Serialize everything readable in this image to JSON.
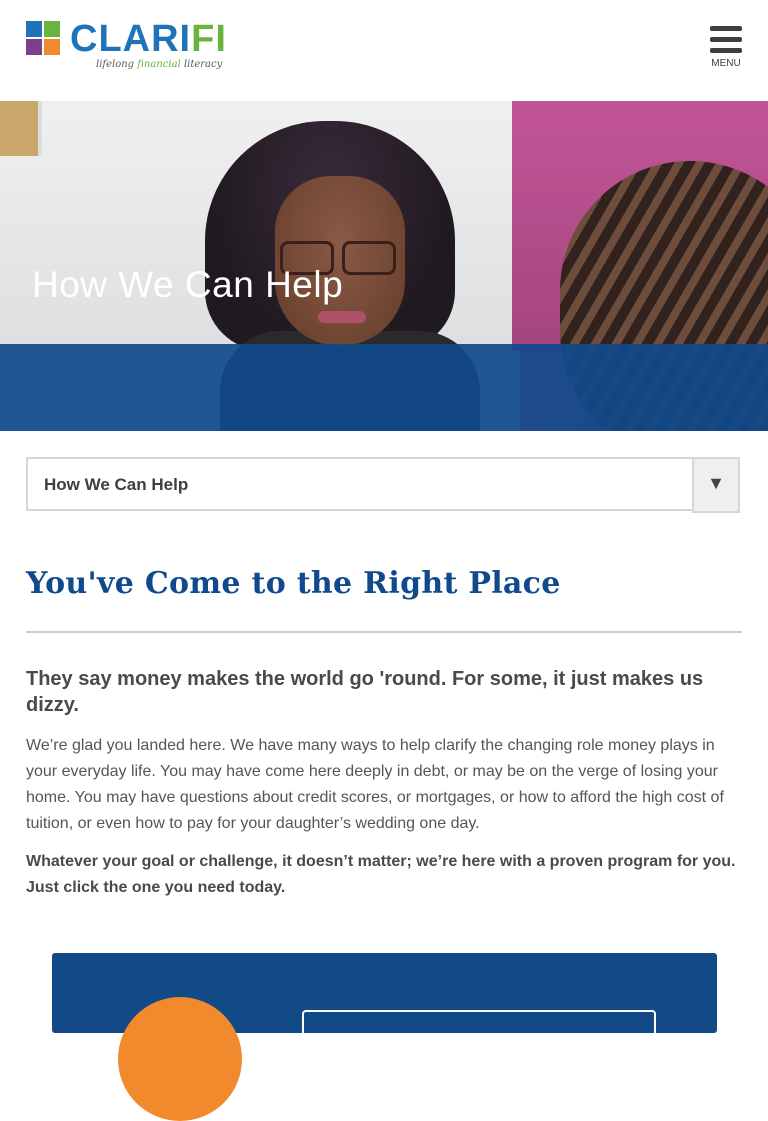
{
  "header": {
    "logo_text_main": "CLARI",
    "logo_text_accent": "FI",
    "tagline_prefix": "lifelong ",
    "tagline_accent": "financial",
    "tagline_suffix": " literacy",
    "menu_label": "MENU"
  },
  "hero": {
    "title": "How We Can Help"
  },
  "nav_select": {
    "value": "How We Can Help",
    "arrow": "▼"
  },
  "content": {
    "section_title": "You've Come to the Right Place",
    "lead": "They say money makes the world go 'round. For some, it just makes us dizzy.",
    "body": "We’re glad you landed here. We have many ways to help clarify the changing role money plays in your everyday life. You may have come here deeply in debt, or may be on the verge of losing your home. You may have questions about credit scores, or mortgages, or how to afford the high cost of tuition, or even how to pay for your daughter’s wedding one day.",
    "cta": "Whatever your goal or challenge, it doesn’t matter; we’re here with a proven program for you. Just click the one you need today."
  },
  "colors": {
    "brand_blue": "#104a8c",
    "logo_blue": "#1e73b9",
    "logo_green": "#6bb33f",
    "card_blue": "#114a87",
    "accent_orange": "#f08a2d"
  },
  "icons": {
    "menu": "hamburger-icon",
    "dropdown": "triangle-down-icon"
  }
}
